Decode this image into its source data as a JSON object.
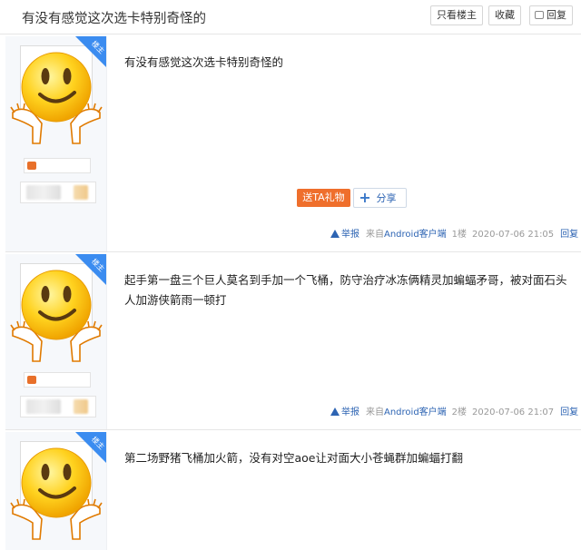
{
  "header": {
    "title": "有没有感觉这次选卡特别奇怪的",
    "only_owner_label": "只看楼主",
    "favorite_label": "收藏",
    "reply_label": "回复"
  },
  "owner_badge_label": "楼主",
  "posts": [
    {
      "content": "有没有感觉这次选卡特别奇怪的",
      "gift_label": "送TA礼物",
      "share_label": "分享",
      "report_label": "举报",
      "source_prefix": "来自",
      "source_link": "Android客户端",
      "floor": "1楼",
      "time": "2020-07-06 21:05",
      "reply_label": "回复"
    },
    {
      "content": "起手第一盘三个巨人莫名到手加一个飞桶，防守治疗冰冻俩精灵加蝙蝠矛哥，被对面石头人加游侠箭雨一顿打",
      "report_label": "举报",
      "source_prefix": "来自",
      "source_link": "Android客户端",
      "floor": "2楼",
      "time": "2020-07-06 21:07",
      "reply_label": "回复"
    },
    {
      "content": "第二场野猪飞桶加火箭，没有对空aoe让对面大小苍蝇群加蝙蝠打翻"
    }
  ],
  "colors": {
    "accent_blue": "#2d64b3",
    "gift_orange": "#ef6f2c",
    "badge_blue": "#3b8cf0",
    "sidebar_bg": "#f6f8fb"
  },
  "icons": {
    "avatar": "smiley-shrug-emoji",
    "report": "warning-triangle-icon",
    "share": "plus-icon",
    "reply": "comment-icon"
  }
}
